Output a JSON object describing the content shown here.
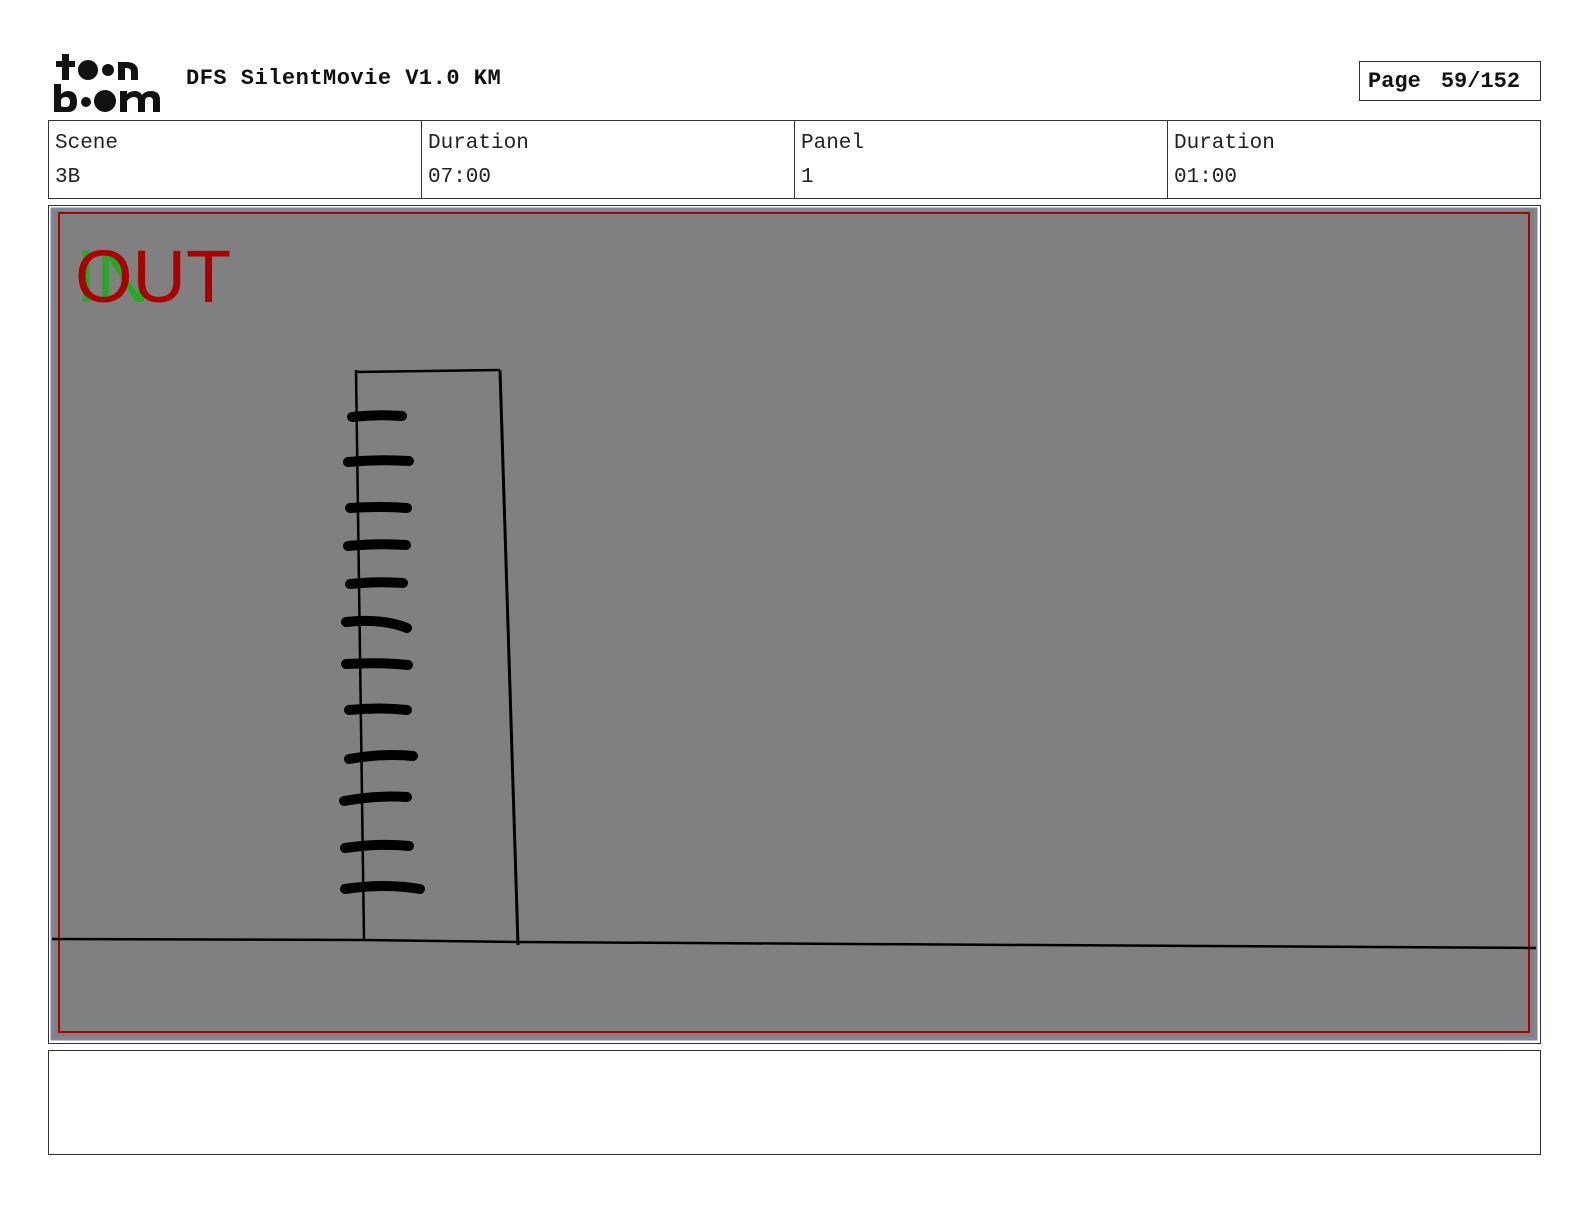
{
  "header": {
    "logo_top": "toon",
    "logo_bottom": "boom",
    "title": "DFS SilentMovie V1.0 KM",
    "page_label": "Page",
    "page_number": "59/152"
  },
  "info": {
    "scene_label": "Scene",
    "scene_value": "3B",
    "scene_duration_label": "Duration",
    "scene_duration_value": "07:00",
    "panel_label": "Panel",
    "panel_value": "1",
    "panel_duration_label": "Duration",
    "panel_duration_value": "01:00"
  },
  "panel": {
    "in_marker": "IN",
    "out_marker": "OUT",
    "in_color": "#22aa22",
    "out_color": "#aa0000",
    "background_color": "#808080",
    "safe_frame_color": "#aa0000"
  },
  "notes": {
    "text": ""
  }
}
